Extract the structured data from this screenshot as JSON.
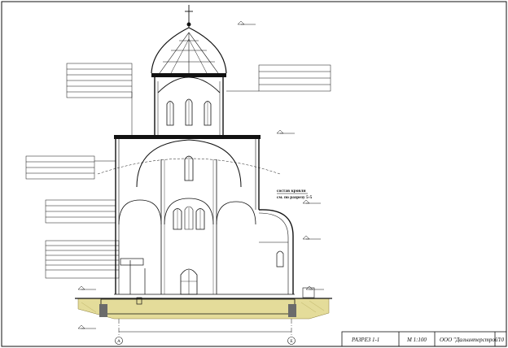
{
  "title_block": {
    "sheet_title": "РАЗРЕЗ 1-1",
    "scale": "М 1:100",
    "company": "ООО \"Дальинтерстрой\"",
    "sheet_cell": "10"
  },
  "section_marker": {
    "line1": "состав кровли",
    "line2": "см. по разрезу 5-5"
  },
  "axes": {
    "left": "А",
    "right": "Е"
  },
  "colors": {
    "ink": "#111111",
    "soil": "#e4dc9a",
    "foundation": "#6b6b6b"
  }
}
